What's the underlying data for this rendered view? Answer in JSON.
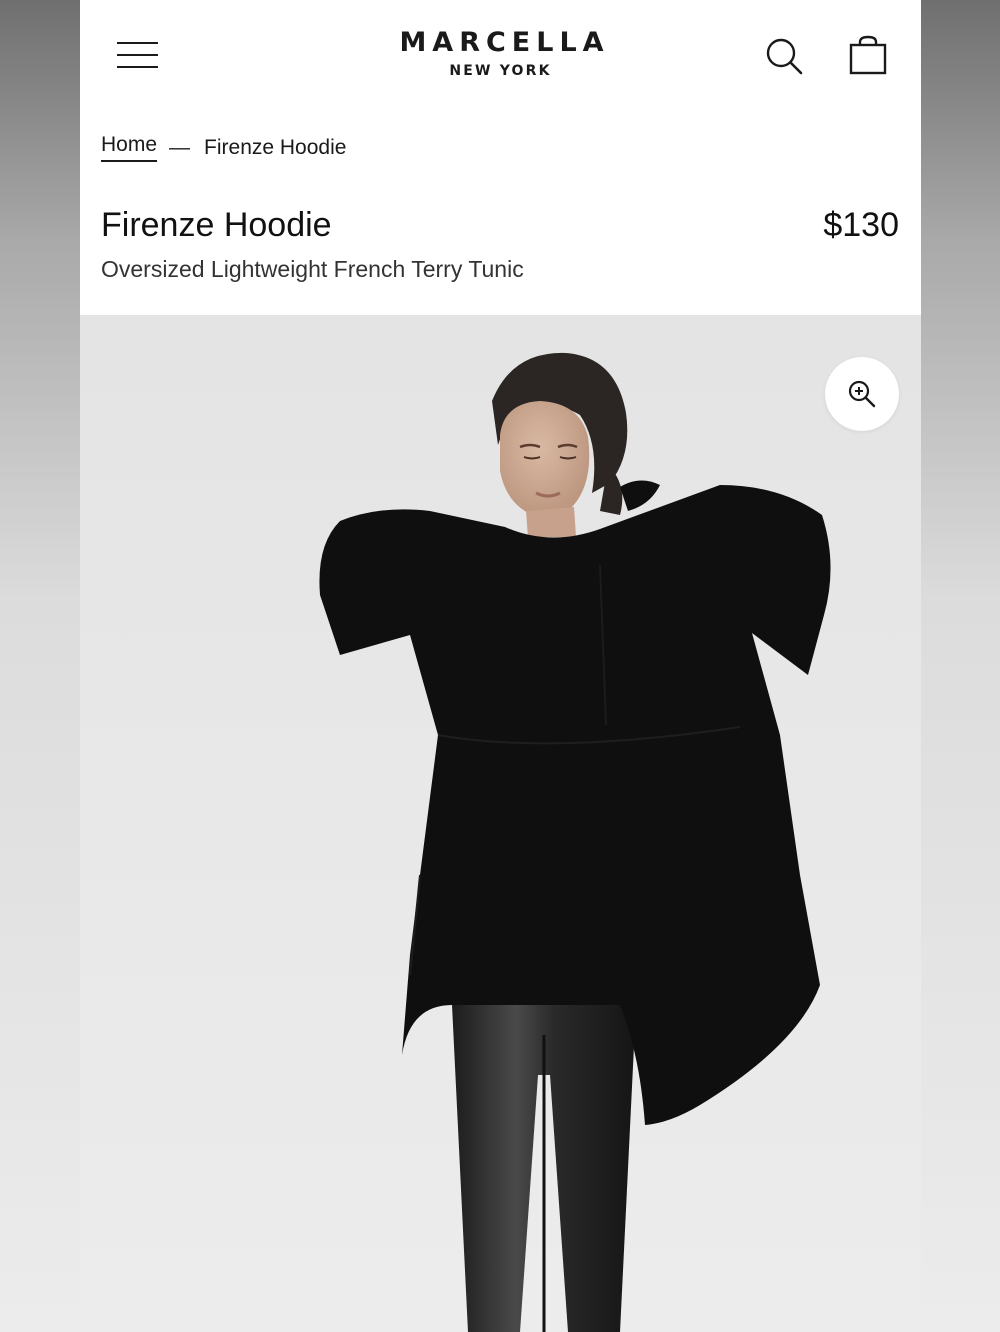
{
  "header": {
    "brand": "MARCELLA",
    "brand_sub": "NEW YORK",
    "menu_icon": "hamburger-menu-icon",
    "search_icon": "search-icon",
    "cart_icon": "shopping-bag-icon"
  },
  "breadcrumb": {
    "home": "Home",
    "separator": "—",
    "current": "Firenze Hoodie"
  },
  "product": {
    "title": "Firenze Hoodie",
    "price": "$130",
    "subtitle": "Oversized Lightweight French Terry Tunic"
  },
  "gallery": {
    "zoom_icon": "zoom-in-icon"
  },
  "colors": {
    "text": "#1a1a1a",
    "background": "#ffffff",
    "hero_bg": "#e7e7e7",
    "garment": "#0f0f0f"
  }
}
